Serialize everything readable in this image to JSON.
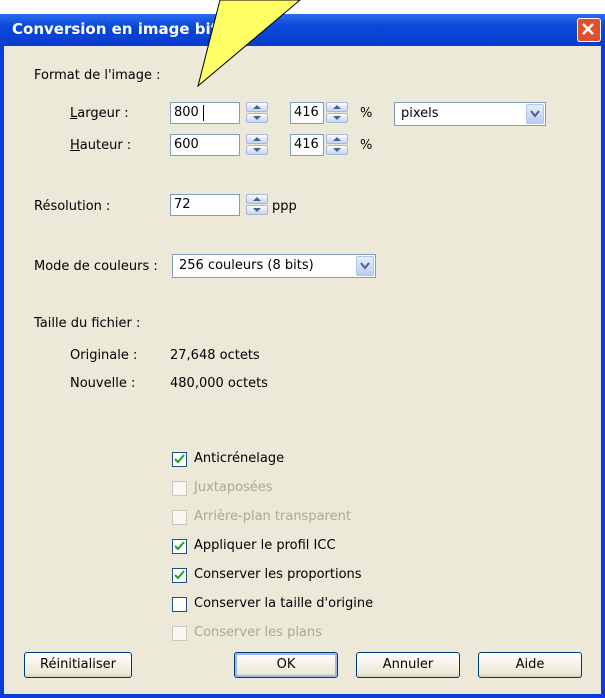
{
  "window": {
    "title": "Conversion en image bitmap",
    "close_icon": "close-icon"
  },
  "format": {
    "section_label": "Format de l'image :",
    "width_label": "Largeur :",
    "height_label": "Hauteur :",
    "width_value": "800",
    "height_value": "600",
    "width_percent": "416",
    "height_percent": "416",
    "percent_sign": "%",
    "unit_value": "pixels"
  },
  "resolution": {
    "label": "Résolution :",
    "value": "72",
    "unit": "ppp"
  },
  "color_mode": {
    "label": "Mode de couleurs :",
    "value": "256 couleurs (8 bits)"
  },
  "file_size": {
    "section_label": "Taille du fichier :",
    "original_label": "Originale :",
    "original_value": "27,648 octets",
    "new_label": "Nouvelle :",
    "new_value": "480,000 octets"
  },
  "options": [
    {
      "label": "Anticrénelage",
      "checked": true,
      "enabled": true
    },
    {
      "label": "Juxtaposées",
      "checked": false,
      "enabled": false
    },
    {
      "label": "Arrière-plan transparent",
      "checked": false,
      "enabled": false
    },
    {
      "label": "Appliquer le profil ICC",
      "checked": true,
      "enabled": true
    },
    {
      "label": "Conserver les proportions",
      "checked": true,
      "enabled": true
    },
    {
      "label": "Conserver la taille d'origine",
      "checked": false,
      "enabled": true
    },
    {
      "label": "Conserver les plans",
      "checked": false,
      "enabled": false
    }
  ],
  "buttons": {
    "reset": "Réinitialiser",
    "ok": "OK",
    "cancel": "Annuler",
    "help": "Aide"
  },
  "colors": {
    "title_bar": "#0a3cd8",
    "dialog_bg": "#ece9d8",
    "callout": "#ffff66"
  }
}
